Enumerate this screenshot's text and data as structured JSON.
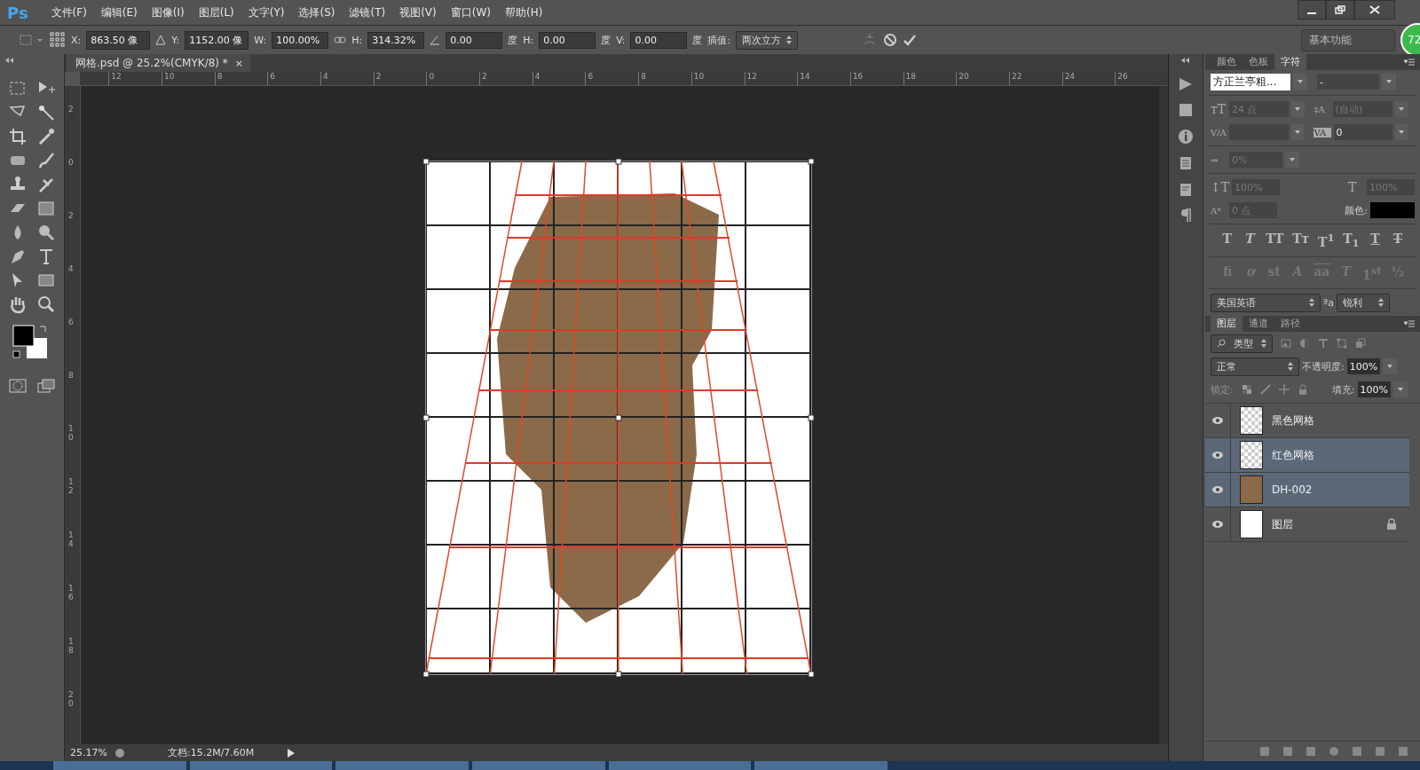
{
  "app_logo": "Ps",
  "menu": [
    "文件(F)",
    "编辑(E)",
    "图像(I)",
    "图层(L)",
    "文字(Y)",
    "选择(S)",
    "滤镜(T)",
    "视图(V)",
    "窗口(W)",
    "帮助(H)"
  ],
  "options_bar": {
    "fields": [
      {
        "label": "X:",
        "value": "863.50 像"
      },
      {
        "label": "Y:",
        "value": "1152.00 像"
      },
      {
        "label": "W:",
        "value": "100.00%"
      },
      {
        "label": "H:",
        "value": "314.32%"
      },
      {
        "value": "0.00",
        "unit": "度"
      },
      {
        "label": "H:",
        "value": "0.00",
        "unit": "度"
      },
      {
        "label": "V:",
        "value": "0.00",
        "unit": "度"
      }
    ],
    "interpolation_label": "插值:",
    "interpolation_value": "两次立方",
    "workspace": "基本功能",
    "badge": "72"
  },
  "document_tab": {
    "title": "网格.psd @ 25.2%(CMYK/8) *",
    "close": "×"
  },
  "ruler": {
    "horizontal": [
      "12",
      "10",
      "8",
      "6",
      "4",
      "2",
      "0",
      "2",
      "4",
      "6",
      "8",
      "10",
      "12",
      "14",
      "16",
      "18",
      "20",
      "22",
      "24",
      "26"
    ],
    "vertical": [
      "2",
      "0",
      "2",
      "4",
      "6",
      "8",
      "10",
      "12",
      "14",
      "16",
      "18",
      "20"
    ]
  },
  "status_bar": {
    "zoom": "25.17%",
    "document": "文档:15.2M/7.60M"
  },
  "character_panel": {
    "tabs": [
      {
        "label": "颜色",
        "selected": false
      },
      {
        "label": "色板",
        "selected": false
      },
      {
        "label": "字符",
        "selected": true
      }
    ],
    "font_family": "方正兰亭粗...",
    "font_style": "-",
    "font_size": "24 点",
    "leading": "(自动)",
    "icon_labels": {
      "font_size": "ᴛT",
      "leading": "‡A",
      "kerning": "V/A",
      "tracking": "VA",
      "tsume": "⇹",
      "vertical_scale": "↕T",
      "horizontal_scale": "T",
      "baseline_shift": "Aª"
    },
    "tracking": "0",
    "tsume": "0%",
    "vertical_scale": "100%",
    "horizontal_scale": "100%",
    "baseline_shift": "0 点",
    "color_label": "颜色:",
    "style_buttons": [
      {
        "kind": "bold",
        "label": "T"
      },
      {
        "kind": "italic",
        "label": "T"
      },
      {
        "kind": "plain",
        "label": "TT"
      },
      {
        "kind": "plain",
        "label": "Tᴛ"
      },
      {
        "kind": "plain",
        "label": "T$^{1}$"
      },
      {
        "kind": "plain",
        "label": "T$_{1}$"
      },
      {
        "kind": "underline",
        "label": "T"
      },
      {
        "kind": "strike",
        "label": "T"
      }
    ],
    "opentype_buttons": [
      {
        "kind": "plain",
        "label": "fi"
      },
      {
        "kind": "italic",
        "label": "ơ"
      },
      {
        "kind": "plain",
        "label": "st"
      },
      {
        "kind": "italic",
        "label": "A"
      },
      {
        "kind": "overline",
        "label": "aa"
      },
      {
        "kind": "italic",
        "label": "T"
      },
      {
        "kind": "plain",
        "label": "1$^{st}$"
      },
      {
        "kind": "plain",
        "label": "½"
      }
    ],
    "language": "美国英语",
    "aa_label": "ªa",
    "antialias": "锐利"
  },
  "layers_panel": {
    "tabs": [
      {
        "label": "图层",
        "selected": true
      },
      {
        "label": "通道",
        "selected": false
      },
      {
        "label": "路径",
        "selected": false
      }
    ],
    "filter": "类型",
    "blend_mode": "正常",
    "opacity_label": "不透明度:",
    "opacity": "100%",
    "lock_label": "锁定:",
    "fill_label": "填充:",
    "fill": "100%",
    "layers": [
      {
        "name": "黑色网格",
        "kind": "transparent",
        "visible": true,
        "selected": false,
        "locked": false
      },
      {
        "name": "红色网格",
        "kind": "transparent",
        "visible": true,
        "selected": true,
        "locked": false
      },
      {
        "name": "DH-002",
        "kind": "photo",
        "visible": true,
        "selected": true,
        "locked": false
      },
      {
        "name": "图层",
        "kind": "white",
        "visible": true,
        "selected": false,
        "locked": true
      }
    ]
  }
}
